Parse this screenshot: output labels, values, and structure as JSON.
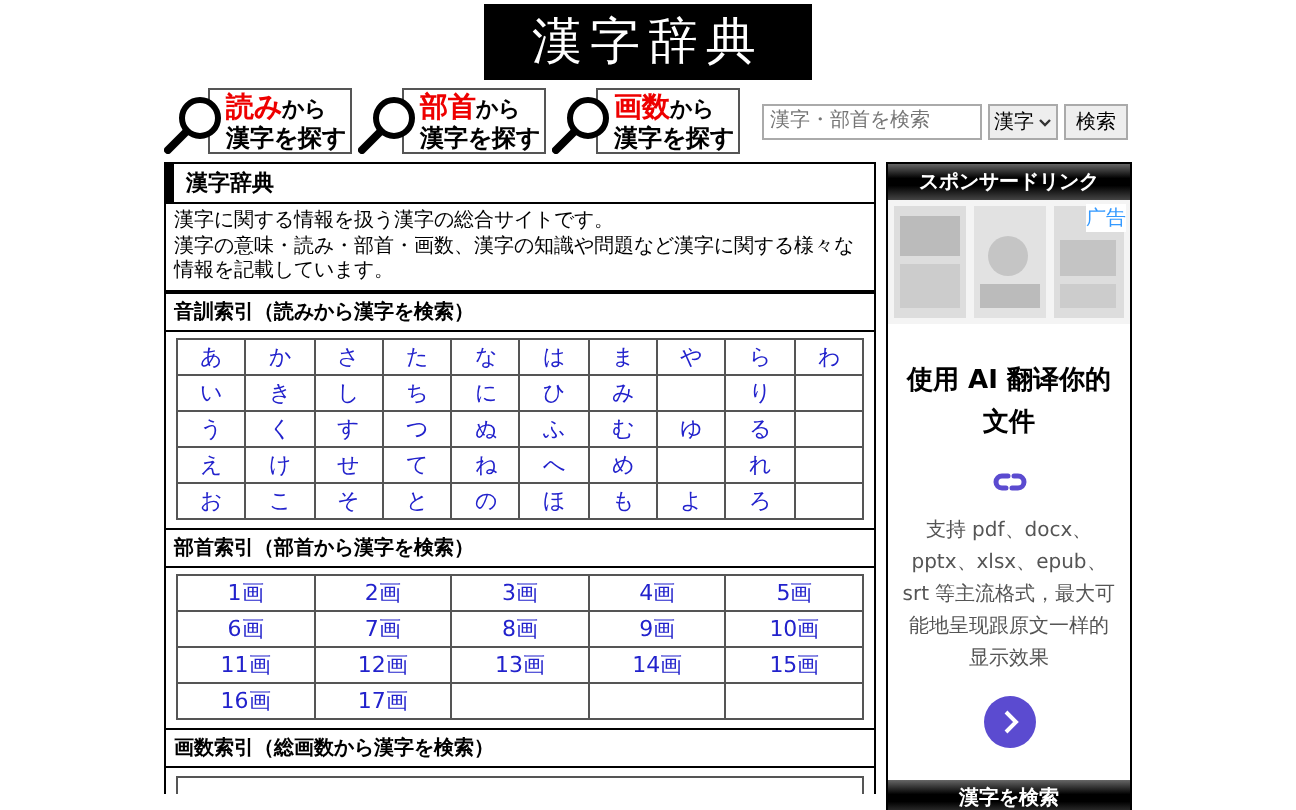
{
  "logo": {
    "text": "漢字辞典"
  },
  "search_buttons": [
    {
      "highlight": "読み",
      "rest": "から",
      "line2": "漢字を探す"
    },
    {
      "highlight": "部首",
      "rest": "から",
      "line2": "漢字を探す"
    },
    {
      "highlight": "画数",
      "rest": "から",
      "line2": "漢字を探す"
    }
  ],
  "search": {
    "placeholder": "漢字・部首を検索",
    "select": "漢字",
    "button": "検索"
  },
  "main": {
    "title": "漢字辞典",
    "description": [
      "漢字に関する情報を扱う漢字の総合サイトです。",
      "漢字の意味・読み・部首・画数、漢字の知識や問題など漢字に関する様々な情報を記載しています。"
    ],
    "sections": [
      {
        "heading": "音訓索引（読みから漢字を検索）",
        "kind": "kana",
        "rows": [
          [
            "あ",
            "か",
            "さ",
            "た",
            "な",
            "は",
            "ま",
            "や",
            "ら",
            "わ"
          ],
          [
            "い",
            "き",
            "し",
            "ち",
            "に",
            "ひ",
            "み",
            null,
            "り",
            null
          ],
          [
            "う",
            "く",
            "す",
            "つ",
            "ぬ",
            "ふ",
            "む",
            "ゆ",
            "る",
            null
          ],
          [
            "え",
            "け",
            "せ",
            "て",
            "ね",
            "へ",
            "め",
            null,
            "れ",
            null
          ],
          [
            "お",
            "こ",
            "そ",
            "と",
            "の",
            "ほ",
            "も",
            "よ",
            "ろ",
            null
          ]
        ]
      },
      {
        "heading": "部首索引（部首から漢字を検索）",
        "kind": "strokes",
        "rows": [
          [
            "1画",
            "2画",
            "3画",
            "4画",
            "5画"
          ],
          [
            "6画",
            "7画",
            "8画",
            "9画",
            "10画"
          ],
          [
            "11画",
            "12画",
            "13画",
            "14画",
            "15画"
          ],
          [
            "16画",
            "17画",
            null,
            null,
            null
          ]
        ]
      },
      {
        "heading": "画数索引（総画数から漢字を検索）",
        "kind": "cut"
      }
    ]
  },
  "sidebar": {
    "header": "スポンサードリンク",
    "ad": {
      "badge": "广告",
      "title": "使用 AI 翻译你的文件",
      "text": "支持 pdf、docx、pptx、xlsx、epub、srt 等主流格式，最大可能地呈现跟原文一样的显示效果"
    },
    "footer": "漢字を検索"
  }
}
